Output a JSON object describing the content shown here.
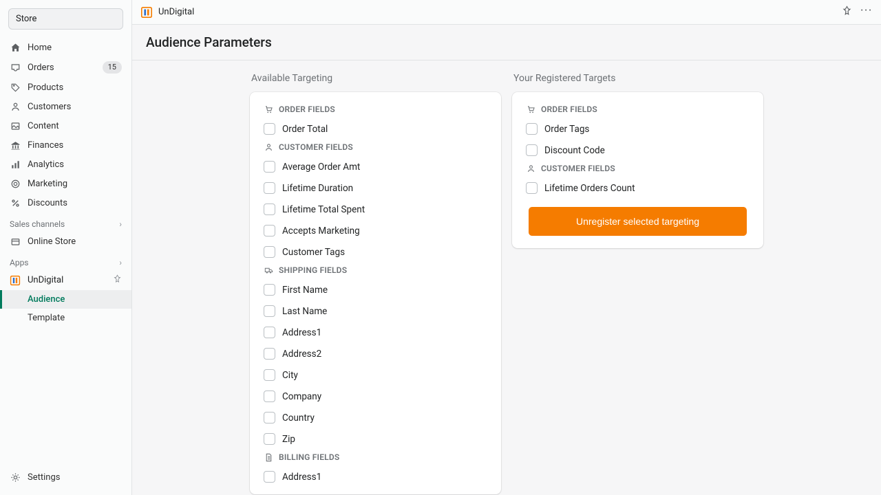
{
  "store_selector": "Store",
  "nav": {
    "home": "Home",
    "orders": "Orders",
    "orders_badge": "15",
    "products": "Products",
    "customers": "Customers",
    "content": "Content",
    "finances": "Finances",
    "analytics": "Analytics",
    "marketing": "Marketing",
    "discounts": "Discounts"
  },
  "sections": {
    "sales_channels": "Sales channels",
    "apps": "Apps"
  },
  "channels": {
    "online_store": "Online Store"
  },
  "apps_list": {
    "undigital": "UnDigital",
    "subs": {
      "audience": "Audience",
      "template": "Template"
    }
  },
  "settings": "Settings",
  "top_app_name": "UnDigital",
  "page_title": "Audience Parameters",
  "columns": {
    "available": "Available Targeting",
    "registered": "Your Registered Targets"
  },
  "groups": {
    "order": "ORDER FIELDS",
    "customer": "CUSTOMER FIELDS",
    "shipping": "SHIPPING FIELDS",
    "billing": "BILLING FIELDS"
  },
  "available": {
    "order": [
      "Order Total"
    ],
    "customer": [
      "Average Order Amt",
      "Lifetime Duration",
      "Lifetime Total Spent",
      "Accepts Marketing",
      "Customer Tags"
    ],
    "shipping": [
      "First Name",
      "Last Name",
      "Address1",
      "Address2",
      "City",
      "Company",
      "Country",
      "Zip"
    ],
    "billing": [
      "Address1"
    ]
  },
  "registered": {
    "order": [
      "Order Tags",
      "Discount Code"
    ],
    "customer": [
      "Lifetime Orders Count"
    ]
  },
  "unregister_btn": "Unregister selected targeting"
}
